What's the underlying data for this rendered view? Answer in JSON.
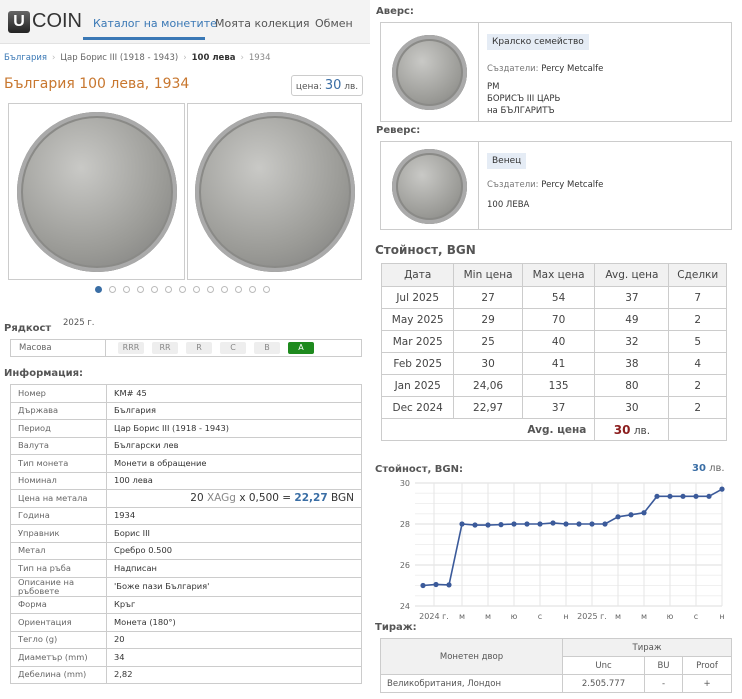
{
  "header": {
    "logo": "COIN",
    "logo_letter": "U",
    "nav": [
      "Каталог на монетите",
      "Моята колекция",
      "Обмен"
    ]
  },
  "breadcrumb": [
    "България",
    "Цар Борис III (1918 - 1943)",
    "100 лева",
    "1934"
  ],
  "title": "България 100 лева, 1934",
  "price_box": {
    "label": "цена:",
    "value": "30",
    "currency": "лв."
  },
  "gallery": {
    "dot_count": 13,
    "active_index": 0
  },
  "rarity": {
    "title": "Рядкост",
    "year": "2025 г.",
    "label": "Масова",
    "levels": [
      "RRR",
      "RR",
      "R",
      "C",
      "B",
      "A"
    ],
    "active": "A",
    "active_color": "#1e8a1e"
  },
  "info": {
    "title": "Информация:",
    "rows": [
      {
        "k": "Номер",
        "v": "KM# 45"
      },
      {
        "k": "Държава",
        "v": "България"
      },
      {
        "k": "Период",
        "v": "Цар Борис III (1918 - 1943)"
      },
      {
        "k": "Валута",
        "v": "Български лев"
      },
      {
        "k": "Тип монета",
        "v": "Монети в обращение"
      },
      {
        "k": "Номинал",
        "v": "100 лева"
      }
    ],
    "metal_row": {
      "k": "Цена на метала",
      "amount": "20",
      "unit": "XAGg",
      "mult": "x 0,500 =",
      "value": "22,27",
      "cur": "BGN"
    },
    "rows2": [
      {
        "k": "Година",
        "v": "1934"
      },
      {
        "k": "Управник",
        "v": "Борис III"
      },
      {
        "k": "Метал",
        "v": "Сребро 0.500"
      },
      {
        "k": "Тип на ръба",
        "v": "Надписан"
      },
      {
        "k": "Описание на ръбовете",
        "v": "'Боже пази България'"
      },
      {
        "k": "Форма",
        "v": "Кръг"
      },
      {
        "k": "Ориентация",
        "v": "Монета (180°)"
      },
      {
        "k": "Тегло (g)",
        "v": "20"
      },
      {
        "k": "Диаметър (mm)",
        "v": "34"
      },
      {
        "k": "Дебелина (mm)",
        "v": "2,82"
      }
    ]
  },
  "obverse": {
    "title": "Аверс:",
    "tag": "Кралско семейство",
    "creators_label": "Създатели:",
    "creators": "Percy Metcalfe",
    "lines": [
      "PM",
      "БОРИСЪ III ЦАРЬ",
      "на БЪЛГАРИТЪ"
    ]
  },
  "reverse": {
    "title": "Реверс:",
    "tag": "Венец",
    "creators_label": "Създатели:",
    "creators": "Percy Metcalfe",
    "lines": [
      "100 ЛЕВА"
    ]
  },
  "value_table": {
    "title": "Стойност, BGN",
    "headers": [
      "Дата",
      "Min цена",
      "Max цена",
      "Avg. цена",
      "Сделки"
    ],
    "rows": [
      [
        "Jul 2025",
        "27",
        "54",
        "37",
        "7"
      ],
      [
        "May 2025",
        "29",
        "70",
        "49",
        "2"
      ],
      [
        "Mar 2025",
        "25",
        "40",
        "32",
        "5"
      ],
      [
        "Feb 2025",
        "30",
        "41",
        "38",
        "4"
      ],
      [
        "Jan 2025",
        "24,06",
        "135",
        "80",
        "2"
      ],
      [
        "Dec 2024",
        "22,97",
        "37",
        "30",
        "2"
      ]
    ],
    "avg_label": "Avg. цена",
    "avg_value": "30",
    "avg_cur": "лв."
  },
  "chart_data": {
    "type": "line",
    "title": "Стойност, BGN:",
    "current_label": "30 лв.",
    "ylim": [
      24,
      30
    ],
    "yticks": [
      "30",
      "28",
      "26",
      "24"
    ],
    "xtick_labels": [
      "2024 г.",
      "м",
      "м",
      "ю",
      "с",
      "н",
      "2025 г.",
      "м",
      "м",
      "ю",
      "с",
      "н"
    ],
    "values": [
      25.0,
      25.05,
      25.03,
      28.0,
      27.95,
      27.95,
      27.97,
      28.0,
      28.0,
      28.0,
      28.05,
      28.0,
      28.0,
      28.0,
      28.0,
      28.35,
      28.45,
      28.55,
      29.35,
      29.35,
      29.35,
      29.35,
      29.35,
      29.7
    ],
    "color": "#3b5a9a",
    "grid": true
  },
  "mintage": {
    "title": "Тираж:",
    "mint_header": "Монетен двор",
    "group_header": "Тираж",
    "cols": [
      "Unc",
      "BU",
      "Proof"
    ],
    "rows": [
      {
        "mint": "Великобритания, Лондон",
        "unc": "2.505.777",
        "bu": "-",
        "proof": "+"
      }
    ]
  }
}
